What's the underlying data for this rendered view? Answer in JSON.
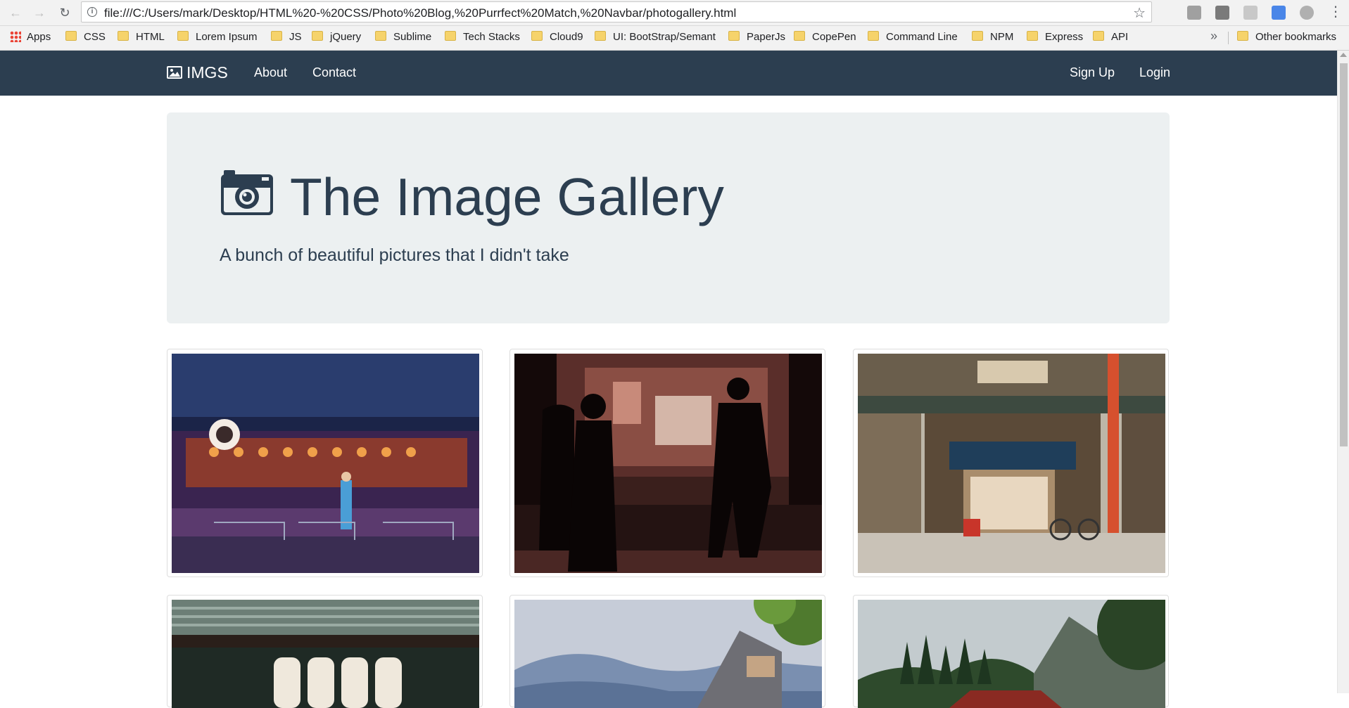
{
  "browser": {
    "url": "file:///C:/Users/mark/Desktop/HTML%20-%20CSS/Photo%20Blog,%20Purrfect%20Match,%20Navbar/photogallery.html",
    "bookmarks": [
      "Apps",
      "CSS",
      "HTML",
      "Lorem Ipsum",
      "JS",
      "jQuery",
      "Sublime",
      "Tech Stacks",
      "Cloud9",
      "UI: BootStrap/Semant",
      "PaperJs",
      "CopePen",
      "Command Line",
      "NPM",
      "Express",
      "API"
    ],
    "more_label": "»",
    "other_bookmarks": "Other bookmarks"
  },
  "navbar": {
    "brand": "IMGS",
    "links": [
      "About",
      "Contact"
    ],
    "right_links": [
      "Sign Up",
      "Login"
    ]
  },
  "jumbotron": {
    "title": "The Image Gallery",
    "subtitle": "A bunch of beautiful pictures that I didn't take"
  },
  "gallery": {
    "photos": [
      {
        "scene": "neon-lit izakaya street at night",
        "colors": [
          "#1b2a5c",
          "#c4543a",
          "#5a3f8c"
        ]
      },
      {
        "scene": "silhouettes walking past a restaurant window",
        "colors": [
          "#1a0d0d",
          "#7a3a36",
          "#3b1e1c"
        ]
      },
      {
        "scene": "traditional Japanese storefront",
        "colors": [
          "#4e4a3f",
          "#1f4a63",
          "#9c8f7a"
        ]
      },
      {
        "scene": "paper lanterns under a tiled roof",
        "colors": [
          "#2a3630",
          "#c9c0b0",
          "#6a7a72"
        ]
      },
      {
        "scene": "mountain valley with a rooftop",
        "colors": [
          "#c9cfd9",
          "#5a7394",
          "#6e8f3c"
        ]
      },
      {
        "scene": "temple among trees and hills",
        "colors": [
          "#bac4c9",
          "#2e4a2c",
          "#8a2a22"
        ]
      }
    ]
  }
}
